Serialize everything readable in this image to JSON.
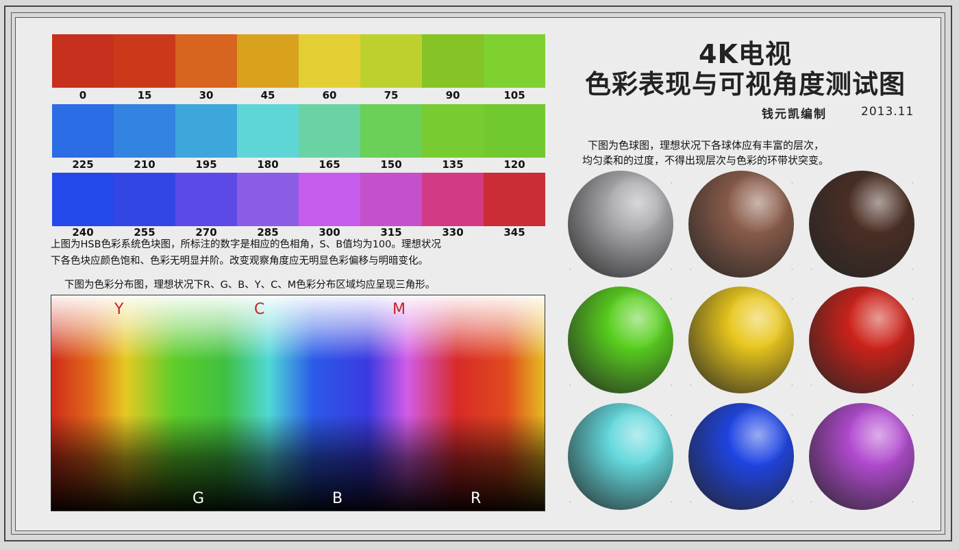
{
  "hue_rows": [
    {
      "hues": [
        "0",
        "15",
        "30",
        "45",
        "60",
        "75",
        "90",
        "105"
      ],
      "colors": [
        "#c6301c",
        "#c9391a",
        "#d8651f",
        "#d9a21e",
        "#e3cf33",
        "#bdd02e",
        "#86c326",
        "#7ed12e"
      ]
    },
    {
      "hues": [
        "225",
        "210",
        "195",
        "180",
        "165",
        "150",
        "135",
        "120"
      ],
      "colors": [
        "#2a6de4",
        "#3384e0",
        "#3da6da",
        "#5fd6d6",
        "#6bd3a3",
        "#6ad058",
        "#78cc32",
        "#72c92f"
      ]
    },
    {
      "hues": [
        "240",
        "255",
        "270",
        "285",
        "300",
        "315",
        "330",
        "345"
      ],
      "colors": [
        "#2448ea",
        "#3246e4",
        "#5b4ae6",
        "#8c5ce4",
        "#c55cec",
        "#c450cc",
        "#d23a86",
        "#cb2c36"
      ]
    }
  ],
  "hsb_description": [
    "上图为HSB色彩系统色块图，所标注的数字是相应的色相角，S、B值均为100。理想状况",
    "下各色块应颜色饱和、色彩无明显并阶。改变观察角度应无明显色彩偏移与明暗变化。"
  ],
  "distribution_caption": "下图为色彩分布图，理想状况下R、G、B、Y、C、M色彩分布区域均应呈现三角形。",
  "distribution_labels_top": [
    "Y",
    "C",
    "M"
  ],
  "distribution_labels_bottom": [
    "G",
    "B",
    "R"
  ],
  "title_line1": "4K电视",
  "title_line2": "色彩表现与可视角度测试图",
  "author": "钱元凯编制",
  "date": "2013.11",
  "sphere_description": [
    "下图为色球图，理想状况下各球体应有丰富的层次，",
    "均匀柔和的过度，不得出现层次与色彩的环带状突变。"
  ],
  "spheres": [
    {
      "name": "gray",
      "color": "#a8a8ac"
    },
    {
      "name": "brown",
      "color": "#8a5c4a"
    },
    {
      "name": "dark-brown",
      "color": "#4a2e24"
    },
    {
      "name": "green",
      "color": "#58cf1e"
    },
    {
      "name": "yellow",
      "color": "#e8c61c"
    },
    {
      "name": "red",
      "color": "#cc2219"
    },
    {
      "name": "cyan",
      "color": "#62d8dc"
    },
    {
      "name": "blue",
      "color": "#1e44e4"
    },
    {
      "name": "purple",
      "color": "#b24ad0"
    }
  ],
  "accent_label_color": "#c42424"
}
